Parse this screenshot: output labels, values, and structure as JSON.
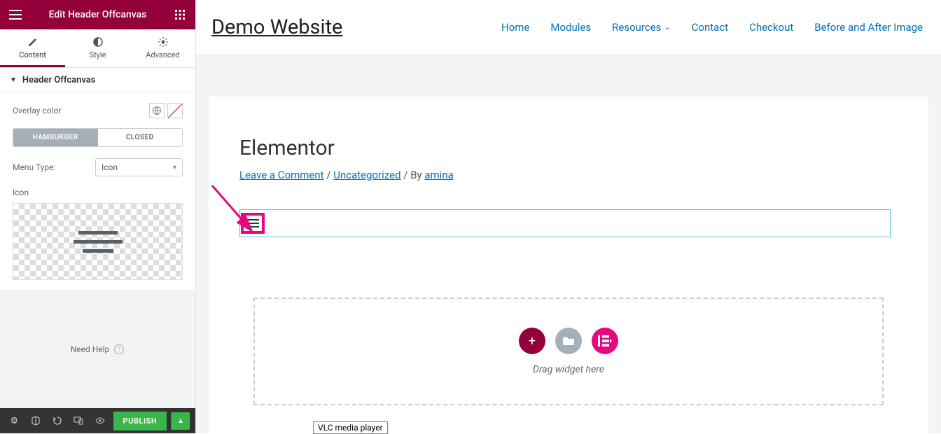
{
  "sidebar": {
    "header_title": "Edit Header Offcanvas",
    "tabs": {
      "content": "Content",
      "style": "Style",
      "advanced": "Advanced"
    },
    "section_title": "Header Offcanvas",
    "overlay_label": "Overlay color",
    "seg_hamburger": "HAMBURGER",
    "seg_closed": "CLOSED",
    "menu_type_label": "Menu Type:",
    "menu_type_value": "Icon",
    "icon_label": "Icon",
    "need_help": "Need Help"
  },
  "footer": {
    "publish": "PUBLISH"
  },
  "site": {
    "title": "Demo Website",
    "nav": {
      "home": "Home",
      "modules": "Modules",
      "resources": "Resources",
      "contact": "Contact",
      "checkout": "Checkout",
      "before_after": "Before and After Image"
    }
  },
  "page": {
    "title": "Elementor",
    "meta_leave": "Leave a Comment",
    "meta_sep1": " / ",
    "meta_cat": "Uncategorized",
    "meta_sep2": " / By ",
    "meta_author": "amina",
    "dropzone": "Drag widget here"
  },
  "tooltip": "VLC media player"
}
